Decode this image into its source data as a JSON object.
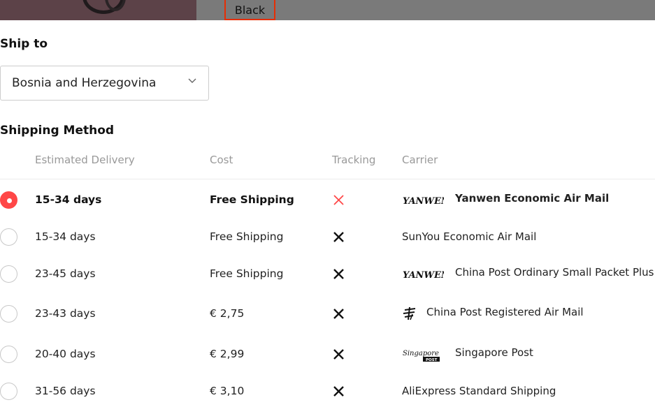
{
  "top_bar": {
    "selected_color": "Black"
  },
  "ship_to": {
    "title": "Ship to",
    "country": "Bosnia and Herzegovina"
  },
  "shipping": {
    "title": "Shipping Method",
    "headers": {
      "delivery": "Estimated Delivery",
      "cost": "Cost",
      "tracking": "Tracking",
      "carrier": "Carrier"
    },
    "rows": [
      {
        "delivery": "15-34 days",
        "cost": "Free Shipping",
        "carrier": "Yanwen Economic Air Mail",
        "logo": "yanwen-logo",
        "logo_text": "YANWEN",
        "selected": true
      },
      {
        "delivery": "15-34 days",
        "cost": "Free Shipping",
        "carrier": "SunYou Economic Air Mail",
        "logo": "",
        "selected": false
      },
      {
        "delivery": "23-45 days",
        "cost": "Free Shipping",
        "carrier": "China Post Ordinary Small Packet Plus",
        "logo": "yanwen-logo",
        "logo_text": "YANWEN",
        "selected": false
      },
      {
        "delivery": "23-43 days",
        "cost": "€ 2,75",
        "carrier": "China Post Registered Air Mail",
        "logo": "china-post-logo",
        "selected": false
      },
      {
        "delivery": "20-40 days",
        "cost": "€ 2,99",
        "carrier": "Singapore Post",
        "logo": "singapore-post-logo",
        "logo_text": "Singapore",
        "logo_subtext": "POST",
        "selected": false
      },
      {
        "delivery": "31-56 days",
        "cost": "€ 3,10",
        "carrier": "AliExpress Standard Shipping",
        "logo": "",
        "selected": false
      }
    ]
  },
  "colors": {
    "accent": "#ff4747",
    "tracking_no_selected": "#ff4747",
    "tracking_no": "#111111",
    "header_text": "#999999"
  },
  "icons": {
    "tracking": "close-icon",
    "select": "chevron-down-icon",
    "radio": "radio-icon"
  }
}
